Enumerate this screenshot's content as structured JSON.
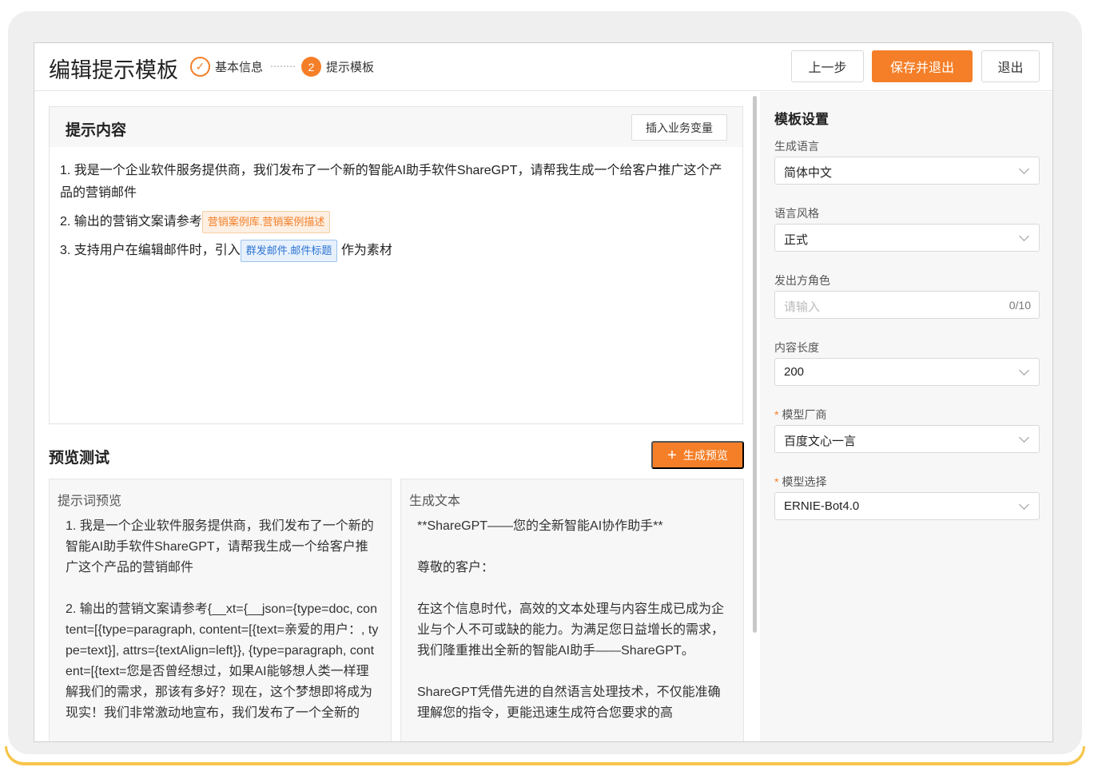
{
  "header": {
    "title": "编辑提示模板",
    "steps": [
      {
        "label": "基本信息",
        "marker": "✓"
      },
      {
        "label": "提示模板",
        "marker": "2"
      }
    ],
    "buttons": {
      "prev": "上一步",
      "save": "保存并退出",
      "exit": "退出"
    }
  },
  "prompt": {
    "title": "提示内容",
    "insert_button": "插入业务变量",
    "lines": [
      {
        "text": "1. 我是一个企业软件服务提供商，我们发布了一个新的智能AI助手软件ShareGPT，请帮我生成一个给客户推广这个产品的营销邮件"
      },
      {
        "prefix": "2. 输出的营销文案请参考",
        "tag": "营销案例库.营销案例描述",
        "suffix": ""
      },
      {
        "prefix": "3. 支持用户在编辑邮件时，引入",
        "tag": "群发邮件.邮件标题",
        "suffix": "作为素材"
      }
    ]
  },
  "preview": {
    "title": "预览测试",
    "generate_button": "生成预览",
    "left": {
      "label": "提示词预览",
      "text": "1. 我是一个企业软件服务提供商，我们发布了一个新的智能AI助手软件ShareGPT，请帮我生成一个给客户推广这个产品的营销邮件\n\n2. 输出的营销文案请参考{__xt={__json={type=doc, content=[{type=paragraph, content=[{text=亲爱的用户：, type=text}], attrs={textAlign=left}}, {type=paragraph, content=[{text=您是否曾经想过，如果AI能够想人类一样理解我们的需求，那该有多好？现在，这个梦想即将成为现实！我们非常激动地宣布，我们发布了一个全新的"
    },
    "right": {
      "label": "生成文本",
      "text": "**ShareGPT——您的全新智能AI协作助手**\n\n尊敬的客户：\n\n在这个信息时代，高效的文本处理与内容生成已成为企业与个人不可或缺的能力。为满足您日益增长的需求，我们隆重推出全新的智能AI助手——ShareGPT。\n\nShareGPT凭借先进的自然语言处理技术，不仅能准确理解您的指令，更能迅速生成符合您要求的高"
    }
  },
  "settings": {
    "title": "模板设置",
    "language": {
      "label": "生成语言",
      "value": "简体中文"
    },
    "style": {
      "label": "语言风格",
      "value": "正式"
    },
    "role": {
      "label": "发出方角色",
      "placeholder": "请输入",
      "count": "0/10"
    },
    "length": {
      "label": "内容长度",
      "value": "200"
    },
    "vendor": {
      "label": "模型厂商",
      "value": "百度文心一言",
      "required_mark": "*"
    },
    "model": {
      "label": "模型选择",
      "value": "ERNIE-Bot4.0",
      "required_mark": "*"
    }
  },
  "colors": {
    "accent": "#f57f28",
    "tag_blue": "#2f74d0",
    "frame_accent": "#f7c54a"
  }
}
